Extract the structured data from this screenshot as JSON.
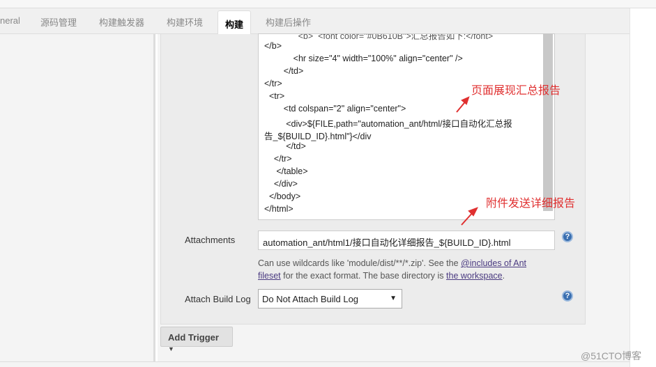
{
  "tabs": [
    {
      "label": "neral"
    },
    {
      "label": "源码管理"
    },
    {
      "label": "构建触发器"
    },
    {
      "label": "构建环境"
    },
    {
      "label": "构建",
      "active": true
    },
    {
      "label": "构建后操作"
    }
  ],
  "content_lines": [
    "</b>",
    "            <hr size=\"4\" width=\"100%\" align=\"center\" />",
    "        </td>",
    "</tr>",
    "  <tr>",
    "        <td colspan=\"2\" align=\"center\">",
    "         <div>${FILE,path=\"automation_ant/html/接口自动化汇总报",
    "告_${BUILD_ID}.html\"}</div",
    "         </td>",
    "    </tr>",
    "     </table>",
    "    </div>",
    "  </body>",
    "</html>"
  ],
  "attachments": {
    "label": "Attachments",
    "value": "automation_ant/html1/接口自动化详细报告_${BUILD_ID}.html"
  },
  "hint": {
    "text1": "Can use wildcards like 'module/dist/**/*.zip'. See the ",
    "link1": "@includes of Ant fileset",
    "text2": " for the exact format. The base directory is ",
    "link2": "the workspace",
    "text3": "."
  },
  "attach_build_log": {
    "label": "Attach Build Log",
    "value": "Do Not Attach Build Log"
  },
  "add_trigger": "Add Trigger",
  "help_glyph": "?",
  "annotations": {
    "summary": "页面展现汇总报告",
    "attachment": "附件发送详细报告",
    "color": "#e03030"
  },
  "watermark": "@51CTO博客"
}
